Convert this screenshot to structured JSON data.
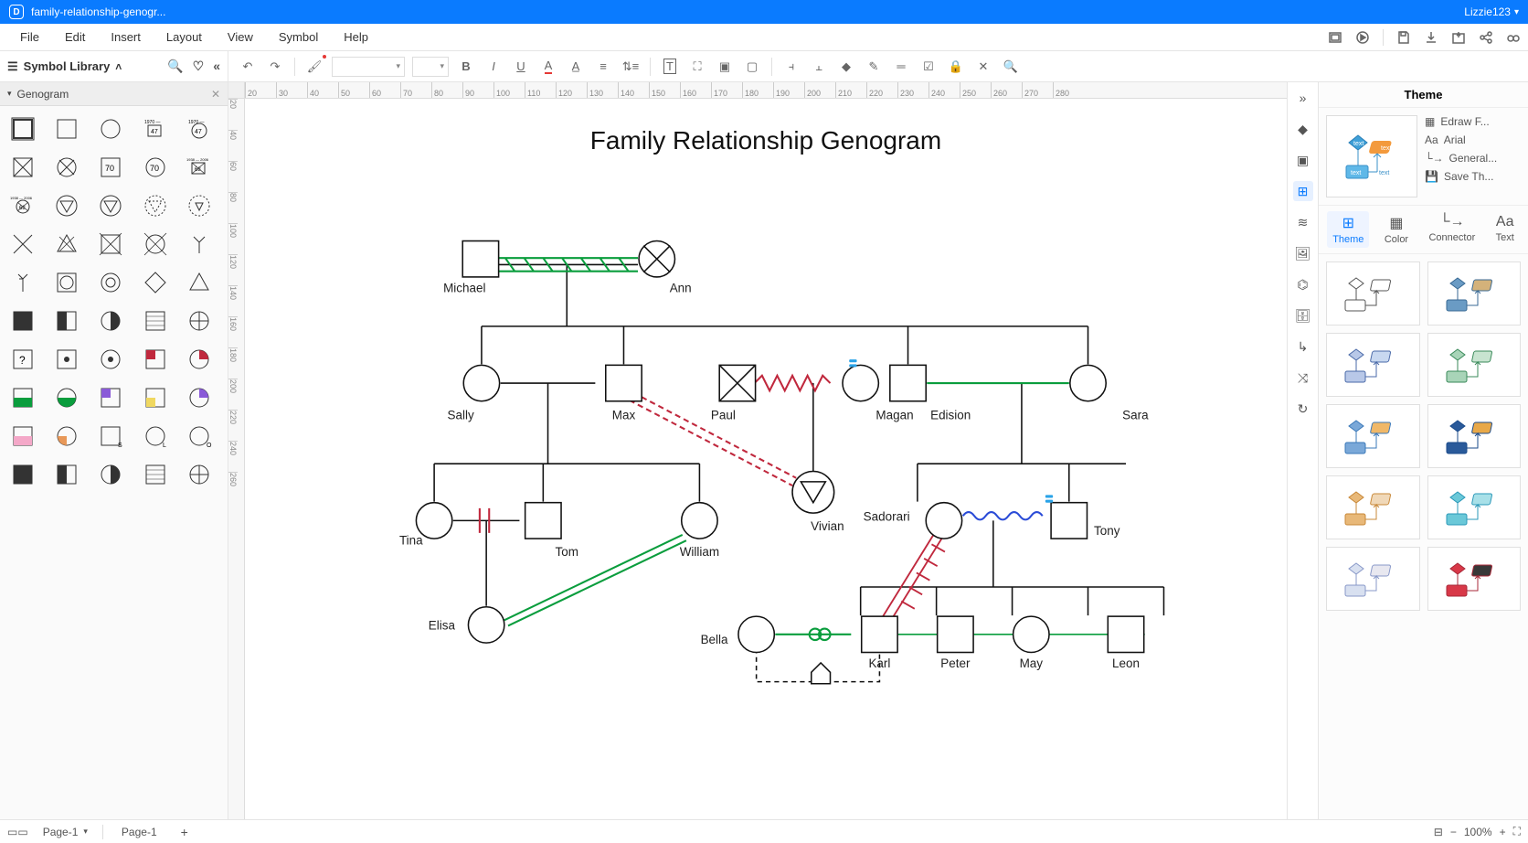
{
  "titlebar": {
    "filename": "family-relationship-genogr...",
    "user": "Lizzie123"
  },
  "menu": {
    "items": [
      "File",
      "Edit",
      "Insert",
      "Layout",
      "View",
      "Symbol",
      "Help"
    ]
  },
  "lib": {
    "title": "Symbol Library",
    "category": "Genogram"
  },
  "canvas": {
    "title": "Family Relationship Genogram",
    "people": {
      "michael": "Michael",
      "ann": "Ann",
      "sally": "Sally",
      "max": "Max",
      "paul": "Paul",
      "magan": "Magan",
      "edision": "Edision",
      "sara": "Sara",
      "tina": "Tina",
      "tom": "Tom",
      "william": "William",
      "vivian": "Vivian",
      "sadorari": "Sadorari",
      "tony": "Tony",
      "elisa": "Elisa",
      "bella": "Bella",
      "karl": "Karl",
      "peter": "Peter",
      "may": "May",
      "leon": "Leon"
    }
  },
  "ruler_h": [
    "20",
    "30",
    "40",
    "50",
    "60",
    "70",
    "80",
    "90",
    "100",
    "110",
    "120",
    "130",
    "140",
    "150",
    "160",
    "170",
    "180",
    "190",
    "200",
    "210",
    "220",
    "230",
    "240",
    "250",
    "260",
    "270",
    "280"
  ],
  "ruler_v": [
    "20",
    "40",
    "60",
    "80",
    "100",
    "120",
    "140",
    "160",
    "180",
    "200",
    "220",
    "240",
    "260"
  ],
  "right_panel": {
    "title": "Theme",
    "opts": {
      "font_family": "Edraw F...",
      "font": "Arial",
      "connector": "General...",
      "save": "Save Th..."
    },
    "tabs": {
      "theme": "Theme",
      "color": "Color",
      "connector": "Connector",
      "text": "Text"
    }
  },
  "bottom": {
    "page_sel": "Page-1",
    "page_tab": "Page-1",
    "zoom": "100%"
  }
}
